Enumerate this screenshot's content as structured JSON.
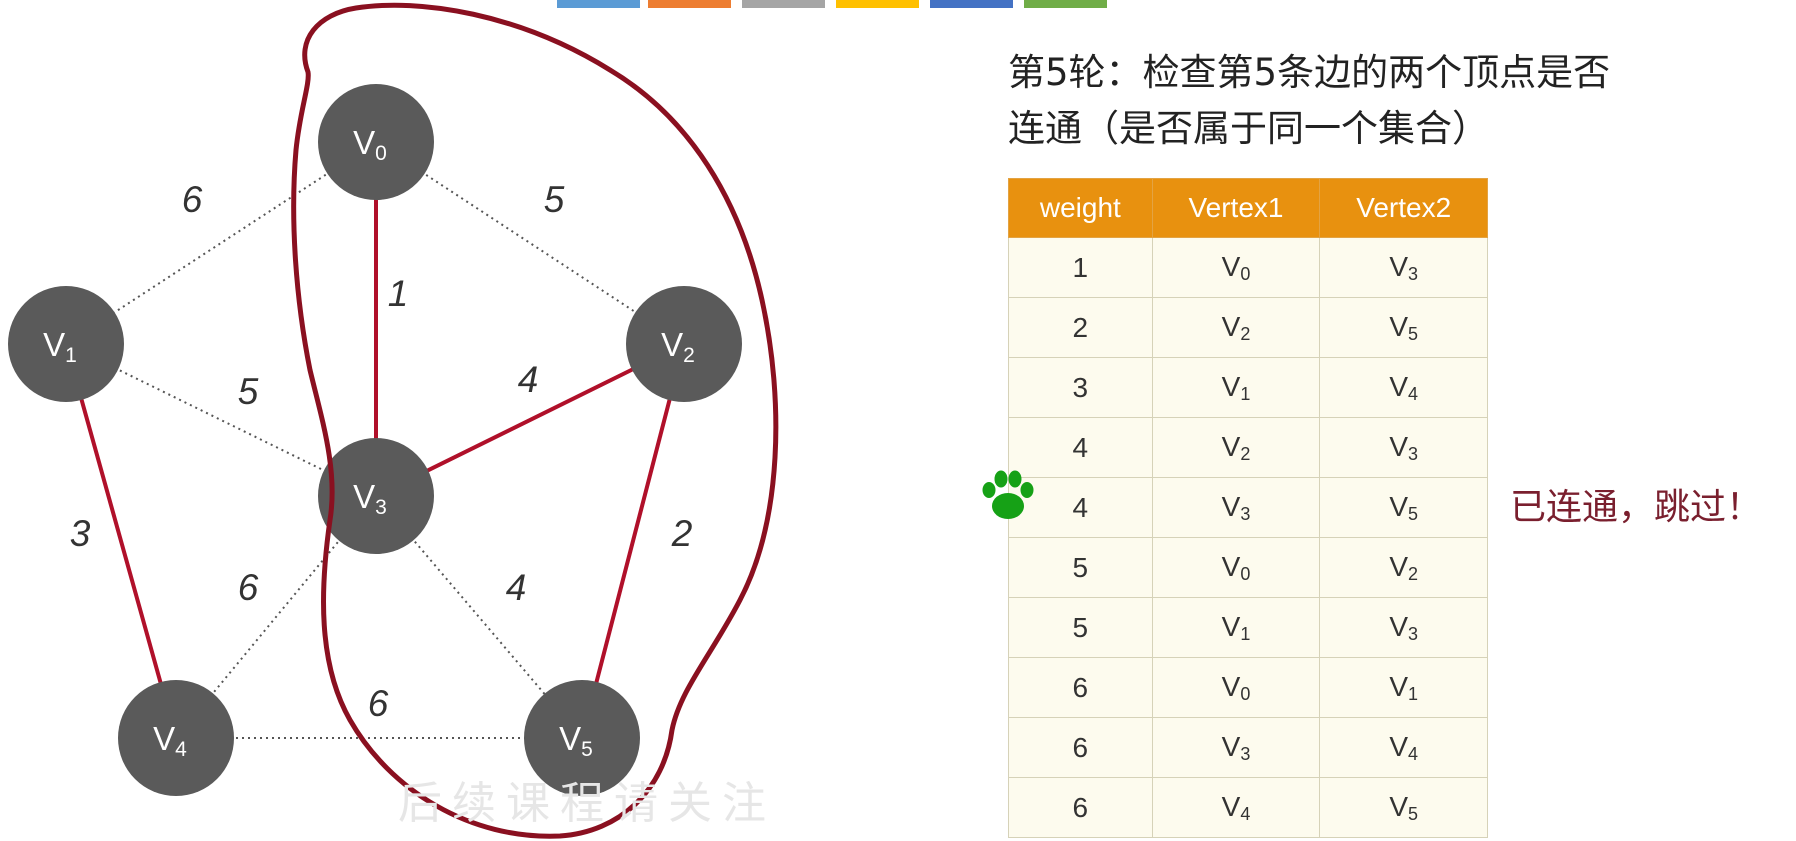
{
  "legend_swatch_colors": [
    "#5b9bd5",
    "#ed7d31",
    "#a5a5a5",
    "#ffc000",
    "#4472c4",
    "#70ad47"
  ],
  "colors": {
    "node_fill": "#5a5a5a",
    "tree_edge": "#b0102a",
    "dotted_edge": "#555555",
    "annotation_circle": "#8a1020",
    "table_header": "#e8910f",
    "paw": "#16a116",
    "skip_note": "#7a1f2e"
  },
  "caption": {
    "line1": "第5轮：检查第5条边的两个顶点是否",
    "line2": "连通（是否属于同一个集合）"
  },
  "nodes": [
    {
      "id": "V0",
      "base": "V",
      "sub": "0"
    },
    {
      "id": "V1",
      "base": "V",
      "sub": "1"
    },
    {
      "id": "V2",
      "base": "V",
      "sub": "2"
    },
    {
      "id": "V3",
      "base": "V",
      "sub": "3"
    },
    {
      "id": "V4",
      "base": "V",
      "sub": "4"
    },
    {
      "id": "V5",
      "base": "V",
      "sub": "5"
    }
  ],
  "edges": [
    {
      "from": "V0",
      "to": "V1",
      "weight": "6",
      "selected": false
    },
    {
      "from": "V0",
      "to": "V2",
      "weight": "5",
      "selected": false
    },
    {
      "from": "V0",
      "to": "V3",
      "weight": "1",
      "selected": true
    },
    {
      "from": "V1",
      "to": "V3",
      "weight": "5",
      "selected": false
    },
    {
      "from": "V1",
      "to": "V4",
      "weight": "3",
      "selected": true
    },
    {
      "from": "V2",
      "to": "V3",
      "weight": "4",
      "selected": true
    },
    {
      "from": "V2",
      "to": "V5",
      "weight": "2",
      "selected": true
    },
    {
      "from": "V3",
      "to": "V4",
      "weight": "6",
      "selected": false
    },
    {
      "from": "V3",
      "to": "V5",
      "weight": "4",
      "selected": false
    },
    {
      "from": "V4",
      "to": "V5",
      "weight": "6",
      "selected": false
    }
  ],
  "table": {
    "headers": [
      "weight",
      "Vertex1",
      "Vertex2"
    ],
    "rows": [
      {
        "weight": "1",
        "v1": {
          "base": "V",
          "sub": "0"
        },
        "v2": {
          "base": "V",
          "sub": "3"
        }
      },
      {
        "weight": "2",
        "v1": {
          "base": "V",
          "sub": "2"
        },
        "v2": {
          "base": "V",
          "sub": "5"
        }
      },
      {
        "weight": "3",
        "v1": {
          "base": "V",
          "sub": "1"
        },
        "v2": {
          "base": "V",
          "sub": "4"
        }
      },
      {
        "weight": "4",
        "v1": {
          "base": "V",
          "sub": "2"
        },
        "v2": {
          "base": "V",
          "sub": "3"
        }
      },
      {
        "weight": "4",
        "v1": {
          "base": "V",
          "sub": "3"
        },
        "v2": {
          "base": "V",
          "sub": "5"
        }
      },
      {
        "weight": "5",
        "v1": {
          "base": "V",
          "sub": "0"
        },
        "v2": {
          "base": "V",
          "sub": "2"
        }
      },
      {
        "weight": "5",
        "v1": {
          "base": "V",
          "sub": "1"
        },
        "v2": {
          "base": "V",
          "sub": "3"
        }
      },
      {
        "weight": "6",
        "v1": {
          "base": "V",
          "sub": "0"
        },
        "v2": {
          "base": "V",
          "sub": "1"
        }
      },
      {
        "weight": "6",
        "v1": {
          "base": "V",
          "sub": "3"
        },
        "v2": {
          "base": "V",
          "sub": "4"
        }
      },
      {
        "weight": "6",
        "v1": {
          "base": "V",
          "sub": "4"
        },
        "v2": {
          "base": "V",
          "sub": "5"
        }
      }
    ],
    "current_row": 4
  },
  "current_row_marker_icon": "paw-icon",
  "skip_note": "已连通，跳过！",
  "watermark": "后续课程请关注"
}
